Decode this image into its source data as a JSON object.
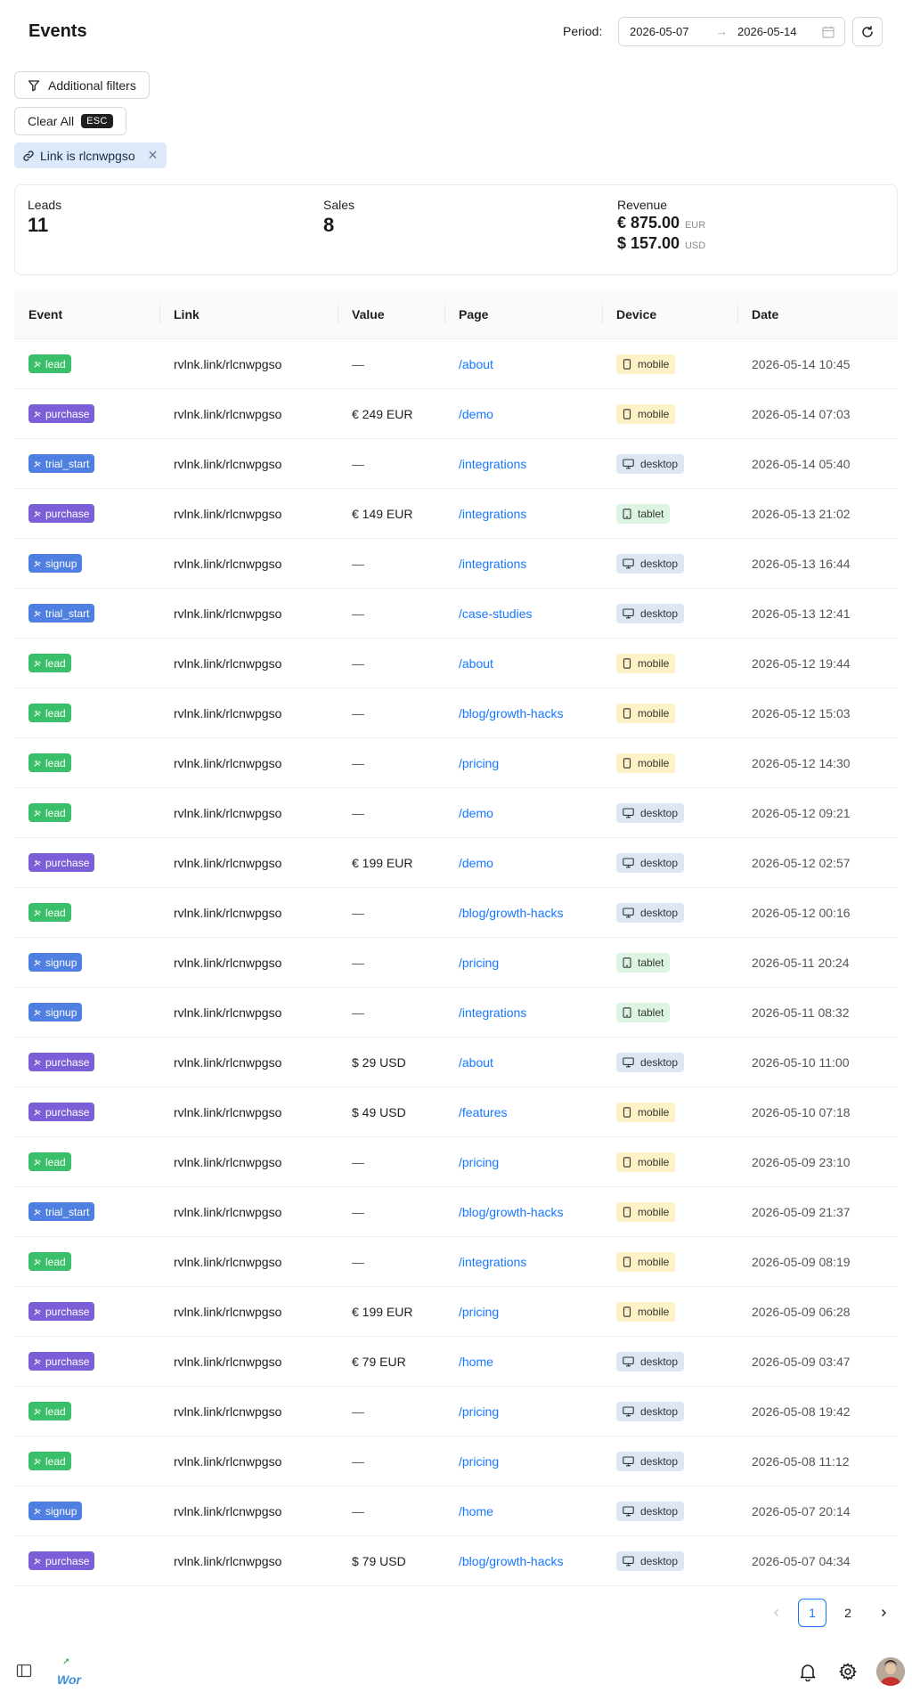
{
  "header": {
    "title": "Events",
    "period_label": "Period:",
    "start_date": "2026-05-07",
    "end_date": "2026-05-14",
    "range_separator": "→"
  },
  "filters": {
    "additional_filters_label": "Additional filters",
    "clear_all_label": "Clear All",
    "clear_all_shortcut": "ESC",
    "active_filter_label": "Link is rlcnwpgso"
  },
  "stats": {
    "leads_label": "Leads",
    "leads_value": "11",
    "sales_label": "Sales",
    "sales_value": "8",
    "revenue_label": "Revenue",
    "revenue_eur_amount": "€ 875.00",
    "revenue_eur_currency": "EUR",
    "revenue_usd_amount": "$ 157.00",
    "revenue_usd_currency": "USD"
  },
  "table": {
    "columns": [
      "Event",
      "Link",
      "Value",
      "Page",
      "Device",
      "Date"
    ],
    "event_colors": {
      "lead": "#3bbf6a",
      "purchase": "#7b5fd6",
      "trial_start": "#4f7fe0",
      "signup": "#4f7fe0"
    },
    "device_colors": {
      "mobile": "#fdf1c7",
      "desktop": "#dde6f3",
      "tablet": "#dbf5e2"
    },
    "rows": [
      {
        "event": "lead",
        "link": "rvlnk.link/rlcnwpgso",
        "value": "—",
        "page": "/about",
        "device": "mobile",
        "date": "2026-05-14 10:45"
      },
      {
        "event": "purchase",
        "link": "rvlnk.link/rlcnwpgso",
        "value": "€ 249 EUR",
        "page": "/demo",
        "device": "mobile",
        "date": "2026-05-14 07:03"
      },
      {
        "event": "trial_start",
        "link": "rvlnk.link/rlcnwpgso",
        "value": "—",
        "page": "/integrations",
        "device": "desktop",
        "date": "2026-05-14 05:40"
      },
      {
        "event": "purchase",
        "link": "rvlnk.link/rlcnwpgso",
        "value": "€ 149 EUR",
        "page": "/integrations",
        "device": "tablet",
        "date": "2026-05-13 21:02"
      },
      {
        "event": "signup",
        "link": "rvlnk.link/rlcnwpgso",
        "value": "—",
        "page": "/integrations",
        "device": "desktop",
        "date": "2026-05-13 16:44"
      },
      {
        "event": "trial_start",
        "link": "rvlnk.link/rlcnwpgso",
        "value": "—",
        "page": "/case-studies",
        "device": "desktop",
        "date": "2026-05-13 12:41"
      },
      {
        "event": "lead",
        "link": "rvlnk.link/rlcnwpgso",
        "value": "—",
        "page": "/about",
        "device": "mobile",
        "date": "2026-05-12 19:44"
      },
      {
        "event": "lead",
        "link": "rvlnk.link/rlcnwpgso",
        "value": "—",
        "page": "/blog/growth-hacks",
        "device": "mobile",
        "date": "2026-05-12 15:03"
      },
      {
        "event": "lead",
        "link": "rvlnk.link/rlcnwpgso",
        "value": "—",
        "page": "/pricing",
        "device": "mobile",
        "date": "2026-05-12 14:30"
      },
      {
        "event": "lead",
        "link": "rvlnk.link/rlcnwpgso",
        "value": "—",
        "page": "/demo",
        "device": "desktop",
        "date": "2026-05-12 09:21"
      },
      {
        "event": "purchase",
        "link": "rvlnk.link/rlcnwpgso",
        "value": "€ 199 EUR",
        "page": "/demo",
        "device": "desktop",
        "date": "2026-05-12 02:57"
      },
      {
        "event": "lead",
        "link": "rvlnk.link/rlcnwpgso",
        "value": "—",
        "page": "/blog/growth-hacks",
        "device": "desktop",
        "date": "2026-05-12 00:16"
      },
      {
        "event": "signup",
        "link": "rvlnk.link/rlcnwpgso",
        "value": "—",
        "page": "/pricing",
        "device": "tablet",
        "date": "2026-05-11 20:24"
      },
      {
        "event": "signup",
        "link": "rvlnk.link/rlcnwpgso",
        "value": "—",
        "page": "/integrations",
        "device": "tablet",
        "date": "2026-05-11 08:32"
      },
      {
        "event": "purchase",
        "link": "rvlnk.link/rlcnwpgso",
        "value": "$ 29 USD",
        "page": "/about",
        "device": "desktop",
        "date": "2026-05-10 11:00"
      },
      {
        "event": "purchase",
        "link": "rvlnk.link/rlcnwpgso",
        "value": "$ 49 USD",
        "page": "/features",
        "device": "mobile",
        "date": "2026-05-10 07:18"
      },
      {
        "event": "lead",
        "link": "rvlnk.link/rlcnwpgso",
        "value": "—",
        "page": "/pricing",
        "device": "mobile",
        "date": "2026-05-09 23:10"
      },
      {
        "event": "trial_start",
        "link": "rvlnk.link/rlcnwpgso",
        "value": "—",
        "page": "/blog/growth-hacks",
        "device": "mobile",
        "date": "2026-05-09 21:37"
      },
      {
        "event": "lead",
        "link": "rvlnk.link/rlcnwpgso",
        "value": "—",
        "page": "/integrations",
        "device": "mobile",
        "date": "2026-05-09 08:19"
      },
      {
        "event": "purchase",
        "link": "rvlnk.link/rlcnwpgso",
        "value": "€ 199 EUR",
        "page": "/pricing",
        "device": "mobile",
        "date": "2026-05-09 06:28"
      },
      {
        "event": "purchase",
        "link": "rvlnk.link/rlcnwpgso",
        "value": "€ 79 EUR",
        "page": "/home",
        "device": "desktop",
        "date": "2026-05-09 03:47"
      },
      {
        "event": "lead",
        "link": "rvlnk.link/rlcnwpgso",
        "value": "—",
        "page": "/pricing",
        "device": "desktop",
        "date": "2026-05-08 19:42"
      },
      {
        "event": "lead",
        "link": "rvlnk.link/rlcnwpgso",
        "value": "—",
        "page": "/pricing",
        "device": "desktop",
        "date": "2026-05-08 11:12"
      },
      {
        "event": "signup",
        "link": "rvlnk.link/rlcnwpgso",
        "value": "—",
        "page": "/home",
        "device": "desktop",
        "date": "2026-05-07 20:14"
      },
      {
        "event": "purchase",
        "link": "rvlnk.link/rlcnwpgso",
        "value": "$ 79 USD",
        "page": "/blog/growth-hacks",
        "device": "desktop",
        "date": "2026-05-07 04:34"
      }
    ]
  },
  "pagination": {
    "pages": [
      "1",
      "2"
    ],
    "current": "1"
  },
  "footer": {
    "logo_text": "Wor",
    "icons": [
      "sidebar-toggle-icon",
      "bell-icon",
      "gear-icon",
      "avatar"
    ]
  }
}
